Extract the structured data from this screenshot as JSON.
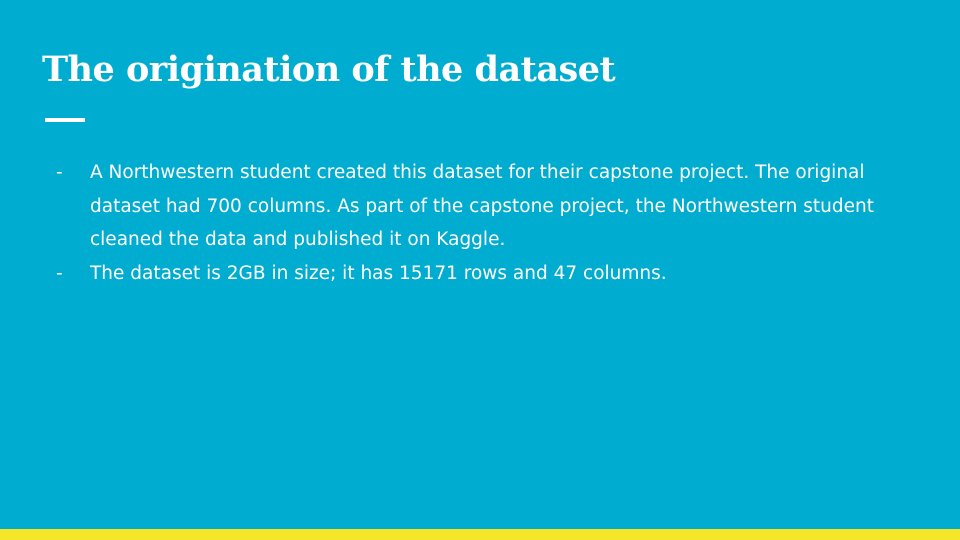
{
  "slide": {
    "title": "The origination of the dataset",
    "bullets": [
      {
        "marker": "-",
        "text": "A Northwestern student created this dataset for their capstone project. The original dataset had 700 columns. As part of the capstone project, the Northwestern student cleaned the data and published it on Kaggle."
      },
      {
        "marker": "-",
        "text": "The dataset is 2GB in size; it has 15171 rows and 47 columns."
      }
    ]
  },
  "colors": {
    "background": "#00acd0",
    "text": "#ffffff",
    "accent_bar": "#f5e62a"
  }
}
